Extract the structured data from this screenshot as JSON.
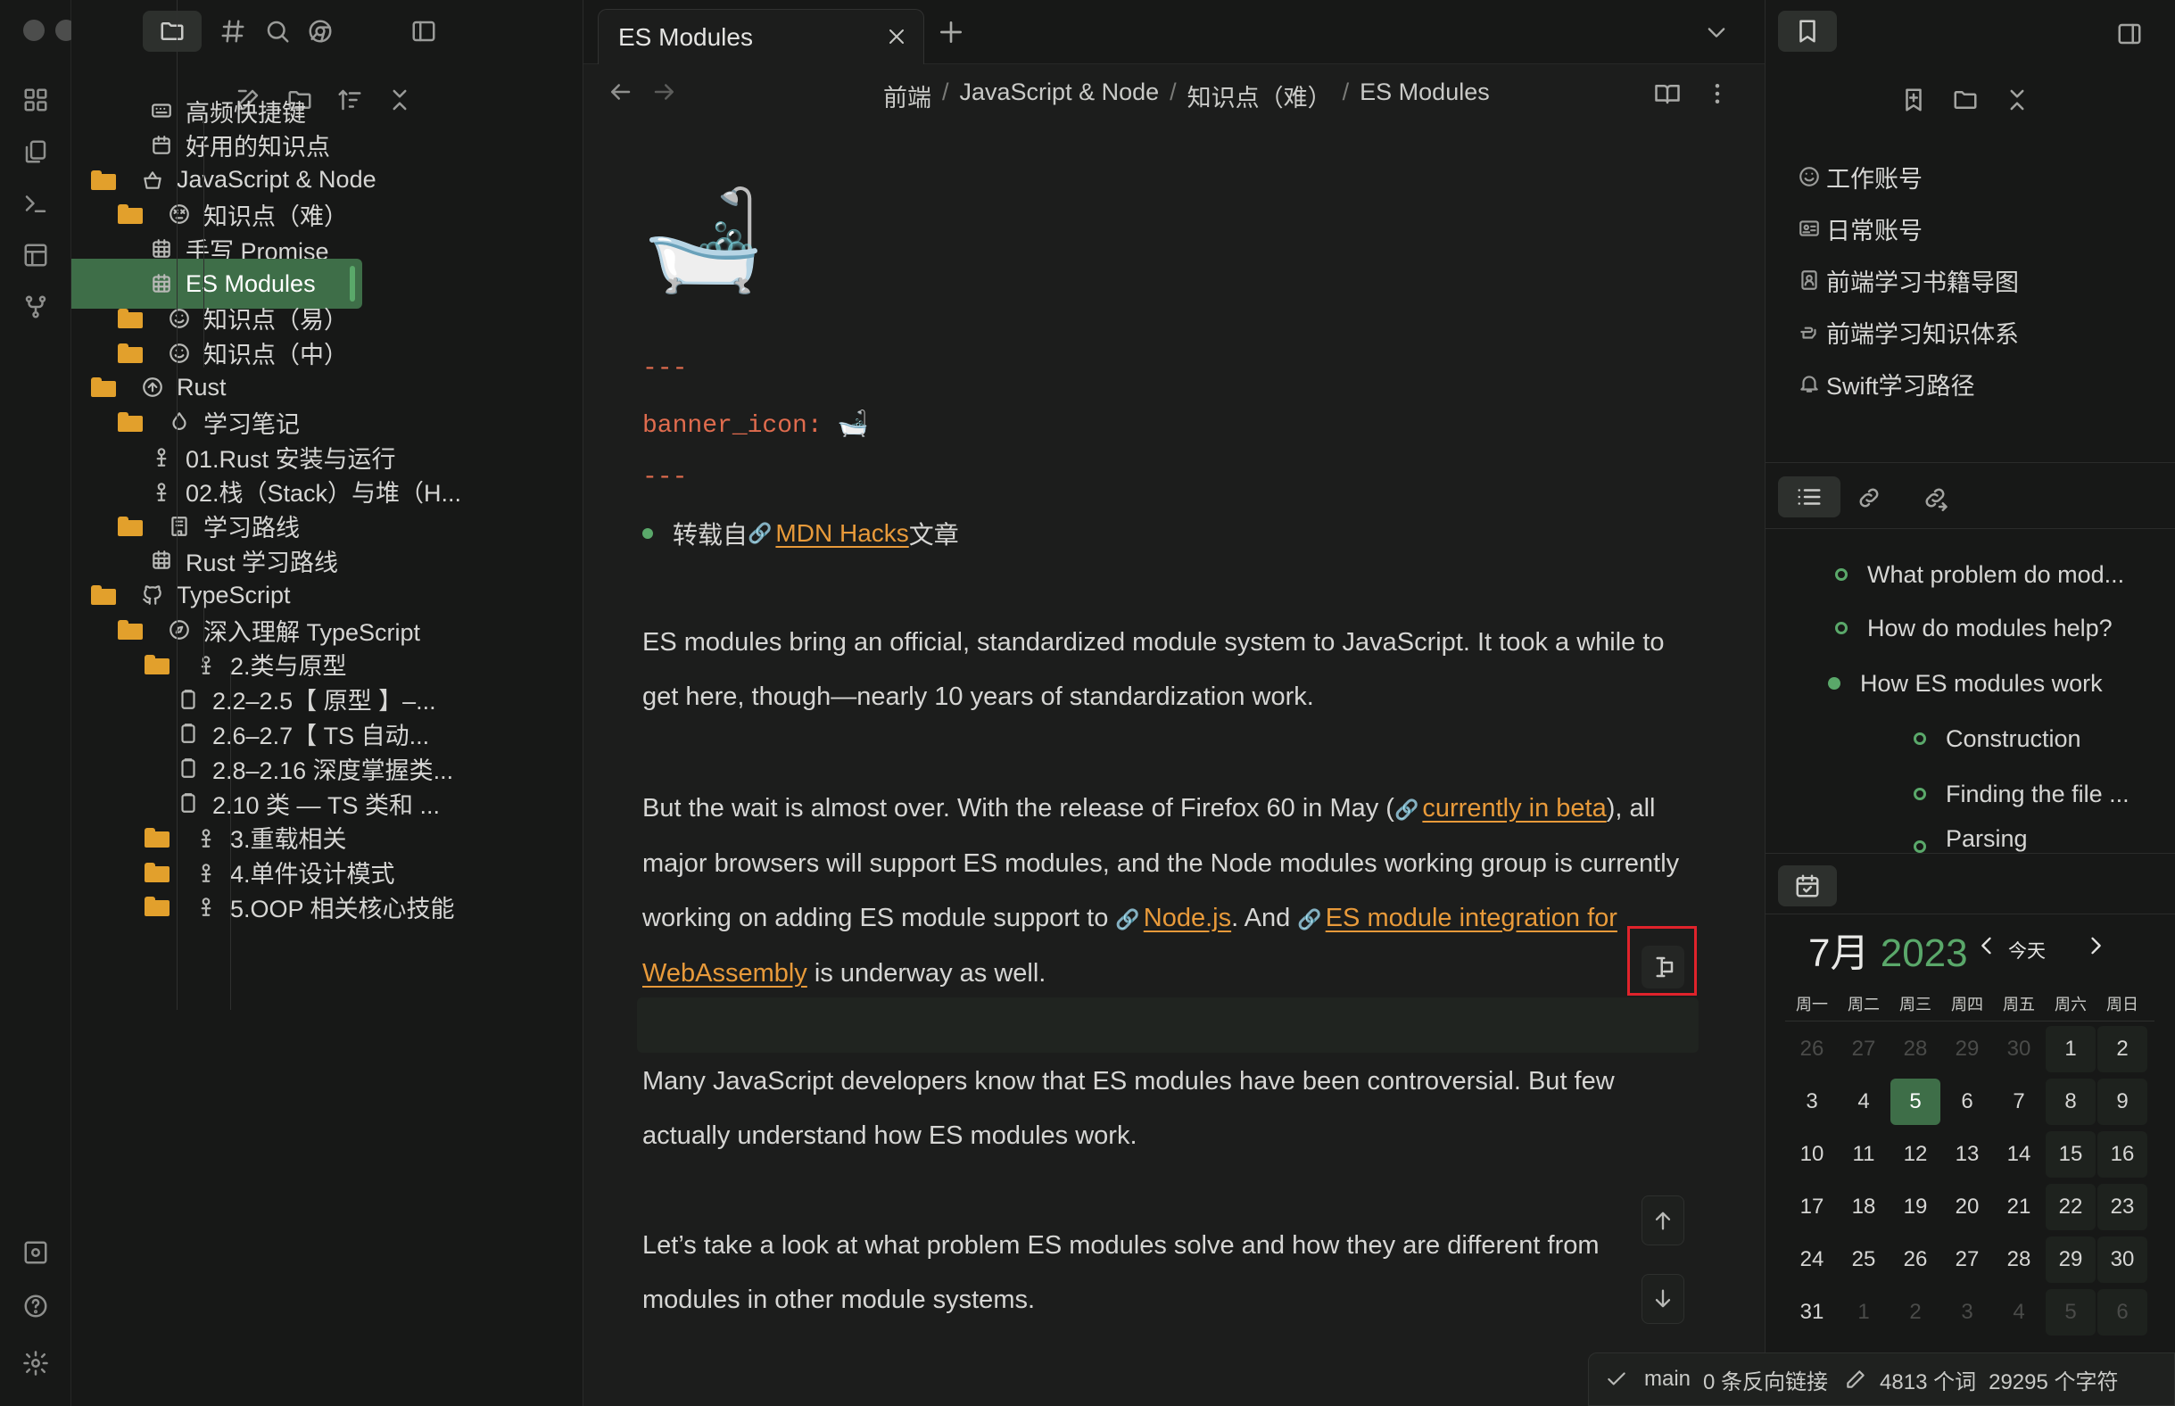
{
  "tab": {
    "title": "ES Modules"
  },
  "breadcrumb": [
    "前端",
    "JavaScript & Node",
    "知识点（难）",
    "ES Modules"
  ],
  "tree": [
    {
      "label": "高频快捷键",
      "icon": "keyboard-icon",
      "folder": false
    },
    {
      "label": "好用的知识点",
      "icon": "calendar-icon",
      "folder": false
    },
    {
      "label": "JavaScript & Node",
      "icon": "basket-icon",
      "folder": true
    },
    {
      "label": "知识点（难）",
      "icon": "dizzy-face-icon",
      "folder": true
    },
    {
      "label": "手写 Promise",
      "icon": "calendar-grid-icon",
      "folder": false
    },
    {
      "label": "ES Modules",
      "icon": "calendar-grid-icon",
      "folder": false
    },
    {
      "label": "知识点（易）",
      "icon": "smile-icon",
      "folder": true
    },
    {
      "label": "知识点（中）",
      "icon": "smile-icon",
      "folder": true
    },
    {
      "label": "Rust",
      "icon": "arrow-circle-icon",
      "folder": true
    },
    {
      "label": "学习笔记",
      "icon": "drop-icon",
      "folder": true
    },
    {
      "label": "01.Rust 安装与运行",
      "icon": "person-icon",
      "folder": false
    },
    {
      "label": "02.栈（Stack）与堆（H...",
      "icon": "person-icon",
      "folder": false
    },
    {
      "label": "学习路线",
      "icon": "building-icon",
      "folder": true
    },
    {
      "label": "Rust 学习路线",
      "icon": "calendar-grid-icon",
      "folder": false
    },
    {
      "label": "TypeScript",
      "icon": "github-icon",
      "folder": true
    },
    {
      "label": "深入理解 TypeScript",
      "icon": "compass-icon",
      "folder": true
    },
    {
      "label": "2.类与原型",
      "icon": "person-icon",
      "folder": true
    },
    {
      "label": "2.2–2.5【 原型 】–...",
      "icon": "clipboard-icon",
      "folder": false
    },
    {
      "label": "2.6–2.7【 TS 自动...",
      "icon": "clipboard-icon",
      "folder": false
    },
    {
      "label": "2.8–2.16 深度掌握类...",
      "icon": "clipboard-icon",
      "folder": false
    },
    {
      "label": "2.10 类 — TS 类和 ...",
      "icon": "clipboard-icon",
      "folder": false
    },
    {
      "label": "3.重载相关",
      "icon": "person-icon",
      "folder": true
    },
    {
      "label": "4.单件设计模式",
      "icon": "person-icon",
      "folder": true
    },
    {
      "label": "5.OOP 相关核心技能",
      "icon": "person-icon",
      "folder": true
    }
  ],
  "note": {
    "banner_glyph": "🛁",
    "fm_delim": "---",
    "fm_key": "banner_icon:",
    "fm_val": "🛁",
    "bullet_prefix": "转载自",
    "bullet_link": "MDN Hacks",
    "bullet_suffix": "文章",
    "p1": "ES modules bring an official, standardized module system to JavaScript. It took a while to get here, though—nearly 10 years of standardization work.",
    "p2_a": "But the wait is almost over. With the release of Firefox 60 in May (",
    "p2_link1": "currently in beta",
    "p2_b": "), all major browsers will support ES modules, and the Node modules working group is currently working on adding ES module support to ",
    "p2_link2": "Node.js",
    "p2_c": ". And ",
    "p2_link3": "ES module integration for WebAssembly",
    "p2_d": " is underway as well.",
    "p3": "Many JavaScript developers know that ES modules have been controversial. But few actually understand how ES modules work.",
    "p4": "Let’s take a look at what problem ES modules solve and how they are different from modules in other module systems."
  },
  "bookmarks": [
    {
      "label": "工作账号",
      "icon": "smiley-icon"
    },
    {
      "label": "日常账号",
      "icon": "id-card-icon"
    },
    {
      "label": "前端学习书籍导图",
      "icon": "contact-icon"
    },
    {
      "label": "前端学习知识体系",
      "icon": "hand-icon"
    },
    {
      "label": "Swift学习路径",
      "icon": "bell-icon"
    }
  ],
  "outline": [
    {
      "label": "What problem do mod...",
      "level": 2
    },
    {
      "label": "How do modules help?",
      "level": 2
    },
    {
      "label": "How ES modules work",
      "level": 1
    },
    {
      "label": "Construction",
      "level": 3
    },
    {
      "label": "Finding the file ...",
      "level": 3
    },
    {
      "label": "Parsing",
      "level": 3
    }
  ],
  "calendar": {
    "month": "7月",
    "year": "2023",
    "today_label": "今天",
    "weekdays": [
      "周一",
      "周二",
      "周三",
      "周四",
      "周五",
      "周六",
      "周日"
    ],
    "days": [
      [
        "26",
        "27",
        "28",
        "29",
        "30",
        "1",
        "2"
      ],
      [
        "3",
        "4",
        "5",
        "6",
        "7",
        "8",
        "9"
      ],
      [
        "10",
        "11",
        "12",
        "13",
        "14",
        "15",
        "16"
      ],
      [
        "17",
        "18",
        "19",
        "20",
        "21",
        "22",
        "23"
      ],
      [
        "24",
        "25",
        "26",
        "27",
        "28",
        "29",
        "30"
      ],
      [
        "31",
        "1",
        "2",
        "3",
        "4",
        "5",
        "6"
      ]
    ],
    "today": "5"
  },
  "status": {
    "branch": "main",
    "backlinks": "0 条反向链接",
    "words": "4813 个词",
    "chars": "29295 个字符"
  }
}
